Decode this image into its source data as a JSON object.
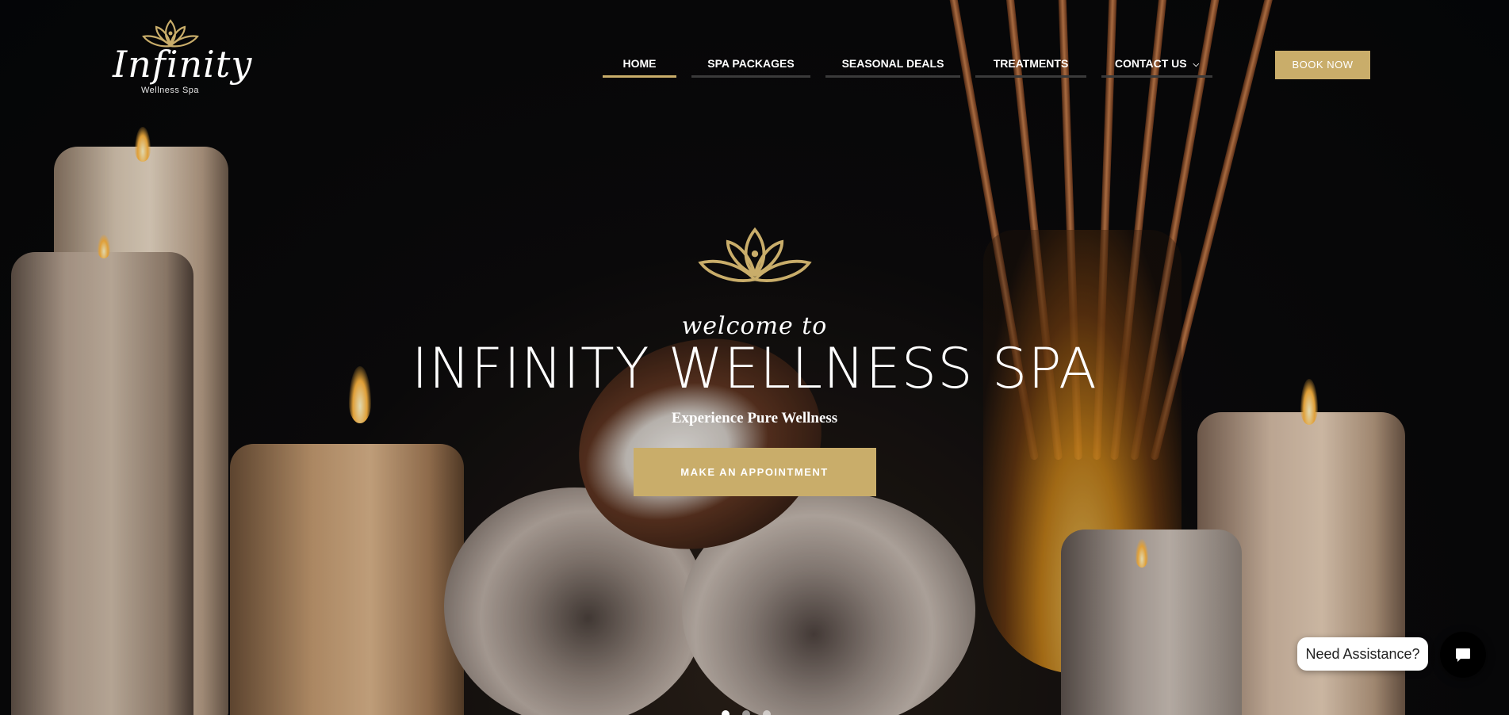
{
  "brand": {
    "logo_script": "Infinity",
    "logo_sub": "Wellness Spa",
    "accent_color": "#c9ad6a"
  },
  "nav": {
    "items": [
      {
        "label": "HOME",
        "active": true
      },
      {
        "label": "SPA PACKAGES",
        "active": false
      },
      {
        "label": "SEASONAL DEALS",
        "active": false
      },
      {
        "label": "TREATMENTS",
        "active": false
      },
      {
        "label": "CONTACT US",
        "active": false,
        "has_dropdown": true
      }
    ],
    "book_label": "BOOK NOW"
  },
  "hero": {
    "welcome": "welcome to",
    "title": "INFINITY WELLNESS SPA",
    "subtitle": "Experience Pure Wellness",
    "cta_label": "MAKE AN APPOINTMENT",
    "lotus_icon": "lotus-icon"
  },
  "slider": {
    "dot_count": 3,
    "active_index": 0
  },
  "chat": {
    "bubble_text": "Need Assistance?",
    "icon": "chat-icon"
  }
}
